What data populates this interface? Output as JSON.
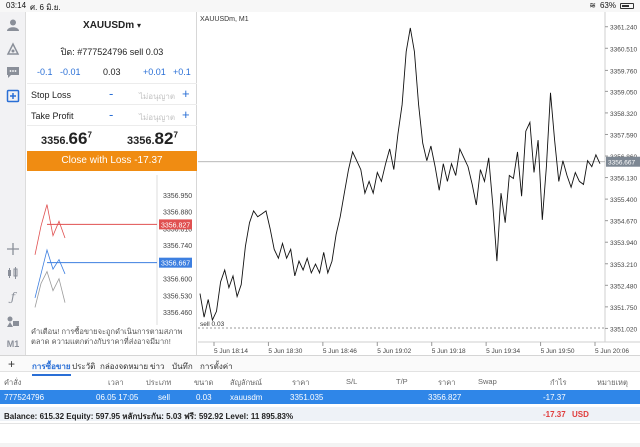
{
  "status_bar": {
    "time": "03:14",
    "date": "ศ. 6 มิ.ย.",
    "battery": "63%"
  },
  "left_tools": [
    {
      "name": "account-icon"
    },
    {
      "name": "trade-icon"
    },
    {
      "name": "chat-icon"
    },
    {
      "name": "new-order-icon"
    },
    {
      "name": "crosshair-icon"
    },
    {
      "name": "candles-icon"
    },
    {
      "name": "indicator-icon"
    },
    {
      "name": "objects-icon"
    },
    {
      "name": "timeframe-m1"
    }
  ],
  "timeframe_label": "M1",
  "order_panel": {
    "symbol": "XAUUSDm",
    "caret": "▾",
    "order_desc": "ปิด: #777524796 sell 0.03",
    "volume": {
      "minus_big": "-0.1",
      "minus_small": "-0.01",
      "value": "0.03",
      "plus_small": "+0.01",
      "plus_big": "+0.1"
    },
    "stop_loss": {
      "label": "Stop Loss",
      "placeholder": "ไม่อนุญาต",
      "minus": "-",
      "plus": "+"
    },
    "take_profit": {
      "label": "Take Profit",
      "placeholder": "ไม่อนุญาต",
      "minus": "-",
      "plus": "+"
    },
    "bid": {
      "prefix": "3356.",
      "big": "66",
      "sup": "7"
    },
    "ask": {
      "prefix": "3356.",
      "big": "82",
      "sup": "7"
    },
    "close_button": "Close with Loss -17.37",
    "warning": "คำเตือน! การซื้อขายจะถูกดำเนินการตามสภาพตลาด ความแตกต่างกับราคาที่ส่งอาจมีมาก!"
  },
  "chart_data": [
    {
      "type": "line",
      "title": "",
      "ylim": [
        3356.44,
        3357.0
      ],
      "y_ticks": [
        "3356.950",
        "3356.880",
        "3356.810",
        "3356.740",
        "3356.670",
        "3356.600",
        "3356.530",
        "3356.460"
      ],
      "ask_label": "3356.827",
      "bid_label": "3356.667",
      "ask_value": 3356.827,
      "bid_value": 3356.667,
      "series": [
        {
          "values": [
            3356.7,
            3356.82,
            3356.91,
            3356.78,
            3356.84,
            3356.77
          ]
        },
        {
          "values": [
            3356.52,
            3356.62,
            3356.72,
            3356.64,
            3356.68,
            3356.62
          ]
        },
        {
          "values": [
            3356.48,
            3356.58,
            3356.63,
            3356.55,
            3356.6,
            3356.5
          ]
        }
      ],
      "colors": {
        "red": "#e05050",
        "blue": "#3d7fe0",
        "gray": "#9a9a9a"
      }
    },
    {
      "type": "line",
      "title": "XAUUSDm, M1",
      "xlabel": "",
      "ylabel": "",
      "ylim": [
        3351.0,
        3361.4
      ],
      "y_ticks": [
        "3361.240",
        "3360.510",
        "3359.760",
        "3359.050",
        "3358.320",
        "3357.590",
        "3356.860",
        "3356.130",
        "3355.400",
        "3354.670",
        "3353.940",
        "3353.210",
        "3352.480",
        "3351.750",
        "3351.020"
      ],
      "x_ticks": [
        "5 Jun 18:14",
        "5 Jun 18:30",
        "5 Jun 18:46",
        "5 Jun 19:02",
        "5 Jun 19:18",
        "5 Jun 19:34",
        "5 Jun 19:50",
        "5 Jun 20:06"
      ],
      "current_price_label": "3356.667",
      "current_price": 3356.667,
      "position_line_label": "sell 0.03",
      "position_price": 3351.035,
      "series": [
        {
          "values": [
            3352.2,
            3351.4,
            3352.0,
            3351.3,
            3351.6,
            3352.6,
            3353.0,
            3352.4,
            3352.8,
            3352.1,
            3352.5,
            3353.8,
            3354.6,
            3355.0,
            3354.8,
            3354.9,
            3355.0,
            3354.4,
            3353.7,
            3353.4,
            3353.9,
            3353.4,
            3353.7,
            3352.8,
            3353.3,
            3353.0,
            3353.4,
            3352.9,
            3353.2,
            3352.9,
            3353.6,
            3352.9,
            3353.3,
            3354.2,
            3354.8,
            3355.6,
            3356.4,
            3357.0,
            3356.7,
            3356.4,
            3355.6,
            3356.0,
            3355.6,
            3356.3,
            3356.0,
            3356.6,
            3357.1,
            3356.4,
            3357.6,
            3358.6,
            3360.4,
            3361.2,
            3360.4,
            3358.6,
            3357.3,
            3356.7,
            3357.2,
            3356.5,
            3355.7,
            3356.6,
            3356.0,
            3356.6,
            3356.2,
            3357.1,
            3356.8,
            3356.5,
            3355.9,
            3355.2,
            3356.4,
            3356.0,
            3356.8,
            3355.2,
            3353.3,
            3355.6,
            3354.6,
            3356.2,
            3356.1,
            3357.0,
            3355.5,
            3357.7,
            3358.0,
            3356.3,
            3357.4,
            3354.7,
            3356.5,
            3359.0,
            3357.4,
            3356.0,
            3356.7,
            3356.2,
            3355.8,
            3356.3,
            3356.0,
            3355.9,
            3356.7,
            3356.5,
            3356.9,
            3356.6
          ]
        }
      ],
      "colors": {
        "line": "#111111",
        "bid_line": "#a0a0a0"
      }
    }
  ],
  "bottom": {
    "tabs": [
      {
        "label": "การซื้อขาย",
        "active": true
      },
      {
        "label": "ประวัติ",
        "active": false
      },
      {
        "label": "กล่องจดหมาย",
        "active": false
      },
      {
        "label": "ข่าว",
        "active": false
      },
      {
        "label": "บันทึก",
        "active": false
      },
      {
        "label": "การตั้งค่า",
        "active": false
      }
    ],
    "columns": [
      "คำสั่ง",
      "เวลา",
      "ประเภท",
      "ขนาด",
      "สัญลักษณ์",
      "ราคา",
      "S/L",
      "T/P",
      "ราคา",
      "Swap",
      "กำไร",
      "หมายเหตุ"
    ],
    "row": {
      "order": "777524796",
      "time": "06.05 17:05",
      "type": "sell",
      "size": "0.03",
      "symbol": "xauusdm",
      "open_price": "3351.035",
      "sl": "",
      "tp": "",
      "price": "3356.827",
      "swap": "",
      "profit": "-17.37",
      "comment": ""
    },
    "balance_text": "Balance: 615.32 Equity: 597.95 หลักประกัน: 5.03 ฟรี: 592.92 Level: 11 895.83%",
    "total_profit": "-17.37",
    "currency": "USD"
  }
}
